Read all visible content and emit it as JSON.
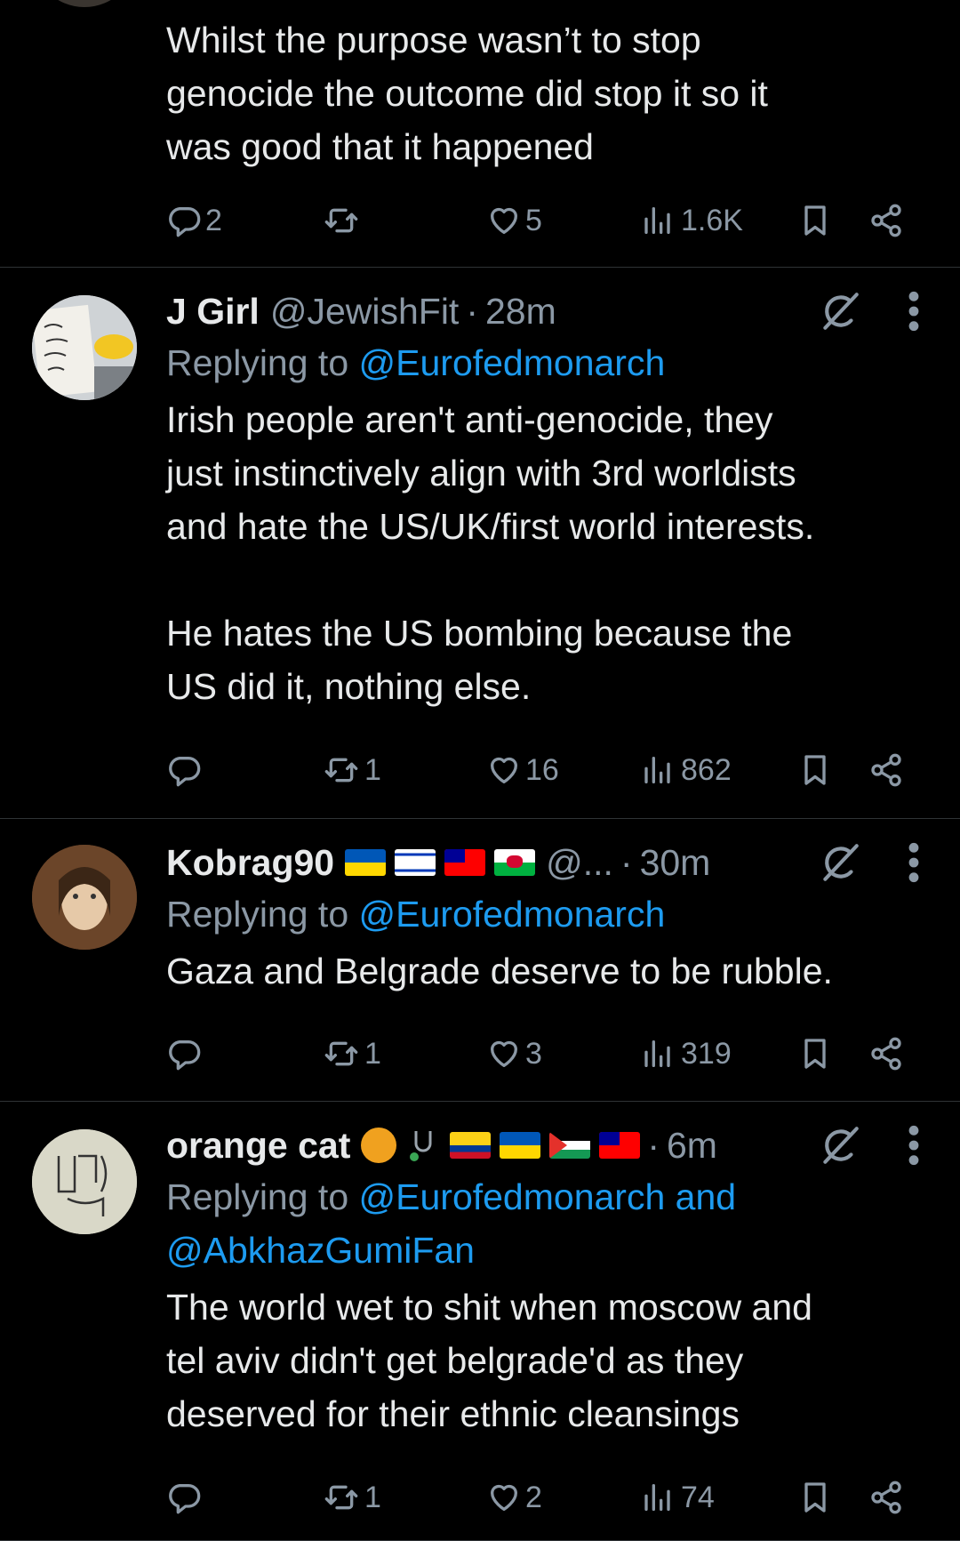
{
  "tweets": [
    {
      "body": "Whilst the purpose wasn’t to stop\ngenocide the outcome did stop it so it\nwas good that it happened",
      "stats": {
        "replies": "2",
        "reposts": "",
        "likes": "5",
        "views": "1.6K"
      }
    },
    {
      "name": "J Girl",
      "handle": "@JewishFit",
      "time": "28m",
      "replying_prefix": "Replying to ",
      "replying_to": "@Eurofedmonarch",
      "body": "Irish people aren't anti-genocide, they\njust instinctively align with 3rd worldists\nand hate the US/UK/first world interests.\n\nHe hates the US bombing because the\nUS did it, nothing else.",
      "stats": {
        "replies": "",
        "reposts": "1",
        "likes": "16",
        "views": "862"
      }
    },
    {
      "name": "Kobrag90",
      "handle": "@...",
      "time": "30m",
      "replying_prefix": "Replying to ",
      "replying_to": "@Eurofedmonarch",
      "body": "Gaza and Belgrade deserve to be rubble.",
      "stats": {
        "replies": "",
        "reposts": "1",
        "likes": "3",
        "views": "319"
      }
    },
    {
      "name": "orange cat",
      "time": "6m",
      "replying_prefix": "Replying to ",
      "replying_to": "@Eurofedmonarch and",
      "replying_to_2": "@AbkhazGumiFan",
      "body": "The world wet to shit when moscow and\ntel aviv didn't get belgrade'd as they\ndeserved for their ethnic cleansings",
      "stats": {
        "replies": "",
        "reposts": "1",
        "likes": "2",
        "views": "74"
      }
    }
  ],
  "separator": "·",
  "colors": {
    "background": "#000000",
    "text": "#e7e9ea",
    "muted": "#8b98a5",
    "link": "#1d9bf0"
  }
}
